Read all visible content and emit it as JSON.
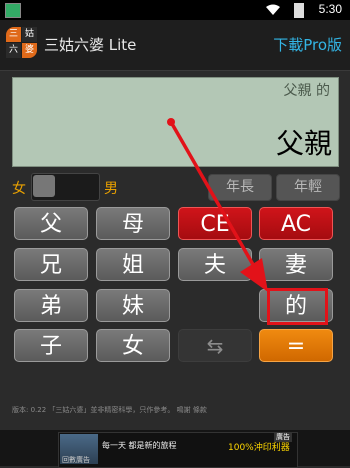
{
  "status_bar": {
    "time": "5:30"
  },
  "action_bar": {
    "icon_chars": [
      "三",
      "姑",
      "六",
      "婆"
    ],
    "title": "三姑六婆 Lite",
    "pro_link": "下載Pro版"
  },
  "display": {
    "expression": "父親 的",
    "result": "父親"
  },
  "gender": {
    "female": "女",
    "male": "男"
  },
  "age_buttons": {
    "older": "年長",
    "younger": "年輕"
  },
  "keys": {
    "father": "父",
    "mother": "母",
    "ce": "CE",
    "ac": "AC",
    "elder_brother": "兄",
    "elder_sister": "姐",
    "husband": "夫",
    "wife": "妻",
    "younger_brother": "弟",
    "younger_sister": "妹",
    "of": "的",
    "son": "子",
    "daughter": "女",
    "swap": "⇆",
    "equals": "="
  },
  "footer": {
    "text": "版本: 0.22  「三姑六婆」並非精密科學，只作參考。 鳴謝  條款"
  },
  "ad": {
    "tag": "廣告",
    "main": "每一天  都是新的旅程",
    "highlight": "100%沖印利器",
    "sub": "回數廣告"
  },
  "colors": {
    "accent": "#33b5e5",
    "key_red": "#c0141a",
    "key_orange": "#e07a00",
    "display_bg": "#b3c7b5",
    "annotation": "#e21219"
  }
}
